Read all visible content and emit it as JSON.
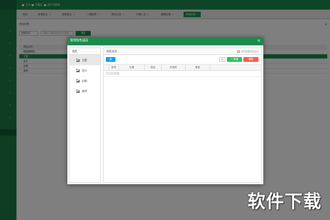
{
  "app": {
    "topbar": [
      "主页",
      "功能区",
      "用户与权限"
    ],
    "tabs": [
      {
        "label": "首页",
        "active": false
      },
      {
        "label": "新增登记",
        "active": false
      },
      {
        "label": "查看登记",
        "active": false
      },
      {
        "label": "一键报表",
        "active": false
      },
      {
        "label": "周边业务",
        "active": false
      },
      {
        "label": "代数汇总",
        "active": false
      },
      {
        "label": "编辑权限",
        "active": false
      },
      {
        "label": "角色权限",
        "active": true
      }
    ],
    "workspace": {
      "title": "角色权限",
      "filter_select": "按照条件",
      "filter_placeholder": "请输入 角色名称 进行搜索",
      "search_button": "搜索",
      "table_header": "角色名称",
      "rows": [
        {
          "label": "超级管理员",
          "selected": false
        },
        {
          "label": "主管",
          "selected": true
        },
        {
          "label": "会计",
          "selected": false
        },
        {
          "label": "出纳",
          "selected": false
        },
        {
          "label": "老师",
          "selected": false
        }
      ]
    }
  },
  "modal": {
    "title": "管理角色成员",
    "close_icon": "close-icon",
    "roles_header": "角色",
    "roles": [
      {
        "label": "主管",
        "active": true
      },
      {
        "label": "会计",
        "active": false
      },
      {
        "label": "出纳",
        "active": false
      },
      {
        "label": "老师",
        "active": false
      }
    ],
    "members_header": "角色成员",
    "hint": "多机构服务在此中",
    "toolbar": {
      "blue_button": "◉",
      "refresh_icon": "↻",
      "add_label": "+ 新增",
      "delete_label": "删除"
    },
    "columns": [
      "序号",
      "头像",
      "姓名",
      "手机号",
      "角色"
    ],
    "empty_text": "暂无相关数据！"
  },
  "watermark": "软件下载",
  "colors": {
    "primary": "#1d8a4c",
    "blue": "#19a0e6",
    "add": "#2ebf61",
    "delete": "#f2604f"
  }
}
